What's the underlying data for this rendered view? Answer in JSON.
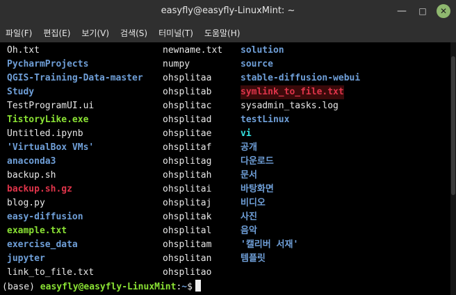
{
  "window": {
    "title": "easyfly@easyfly-LinuxMint: ~",
    "minimize_glyph": "—",
    "maximize_glyph": "□",
    "close_glyph": "✕"
  },
  "menu": [
    "파일(F)",
    "편집(E)",
    "보기(V)",
    "검색(S)",
    "터미널(T)",
    "도움말(H)"
  ],
  "listing": [
    [
      {
        "t": "Oh.txt",
        "k": "white"
      },
      {
        "t": "newname.txt",
        "k": "white"
      },
      {
        "t": "solution",
        "k": "dir"
      }
    ],
    [
      {
        "t": "PycharmProjects",
        "k": "dir"
      },
      {
        "t": "numpy",
        "k": "white"
      },
      {
        "t": "source",
        "k": "dir"
      }
    ],
    [
      {
        "t": "QGIS-Training-Data-master",
        "k": "dir"
      },
      {
        "t": "ohsplitaa",
        "k": "white"
      },
      {
        "t": "stable-diffusion-webui",
        "k": "dir"
      }
    ],
    [
      {
        "t": "Study",
        "k": "dir"
      },
      {
        "t": "ohsplitab",
        "k": "white"
      },
      {
        "t": "symlink_to_file.txt",
        "k": "broken"
      }
    ],
    [
      {
        "t": "TestProgramUI.ui",
        "k": "white"
      },
      {
        "t": "ohsplitac",
        "k": "white"
      },
      {
        "t": "sysadmin_tasks.log",
        "k": "white"
      }
    ],
    [
      {
        "t": "TistoryLike.exe",
        "k": "exec"
      },
      {
        "t": "ohsplitad",
        "k": "white"
      },
      {
        "t": "testLinux",
        "k": "dir"
      }
    ],
    [
      {
        "t": "Untitled.ipynb",
        "k": "white"
      },
      {
        "t": "ohsplitae",
        "k": "white"
      },
      {
        "t": "vi",
        "k": "cyan"
      }
    ],
    [
      {
        "t": "'VirtualBox VMs'",
        "k": "dir"
      },
      {
        "t": "ohsplitaf",
        "k": "white"
      },
      {
        "t": "공개",
        "k": "dir"
      }
    ],
    [
      {
        "t": "anaconda3",
        "k": "dir"
      },
      {
        "t": "ohsplitag",
        "k": "white"
      },
      {
        "t": "다운로드",
        "k": "dir"
      }
    ],
    [
      {
        "t": "backup.sh",
        "k": "white"
      },
      {
        "t": "ohsplitah",
        "k": "white"
      },
      {
        "t": "문서",
        "k": "dir"
      }
    ],
    [
      {
        "t": "backup.sh.gz",
        "k": "archive"
      },
      {
        "t": "ohsplitai",
        "k": "white"
      },
      {
        "t": "바탕화면",
        "k": "dir"
      }
    ],
    [
      {
        "t": "blog.py",
        "k": "white"
      },
      {
        "t": "ohsplitaj",
        "k": "white"
      },
      {
        "t": "비디오",
        "k": "dir"
      }
    ],
    [
      {
        "t": "easy-diffusion",
        "k": "dir"
      },
      {
        "t": "ohsplitak",
        "k": "white"
      },
      {
        "t": "사진",
        "k": "dir"
      }
    ],
    [
      {
        "t": "example.txt",
        "k": "exec"
      },
      {
        "t": "ohsplital",
        "k": "white"
      },
      {
        "t": "음악",
        "k": "dir"
      }
    ],
    [
      {
        "t": "exercise_data",
        "k": "dir"
      },
      {
        "t": "ohsplitam",
        "k": "white"
      },
      {
        "t": "'캘리버 서재'",
        "k": "dir"
      }
    ],
    [
      {
        "t": "jupyter",
        "k": "dir"
      },
      {
        "t": "ohsplitan",
        "k": "white"
      },
      {
        "t": "템플릿",
        "k": "dir"
      }
    ],
    [
      {
        "t": "link_to_file.txt",
        "k": "white"
      },
      {
        "t": "ohsplitao",
        "k": "white"
      },
      {
        "t": "",
        "k": "white"
      }
    ]
  ],
  "prompt": {
    "env": "(base)",
    "user_host": "easyfly@easyfly-LinuxMint",
    "sep": ":",
    "path": "~",
    "symbol": "$"
  }
}
